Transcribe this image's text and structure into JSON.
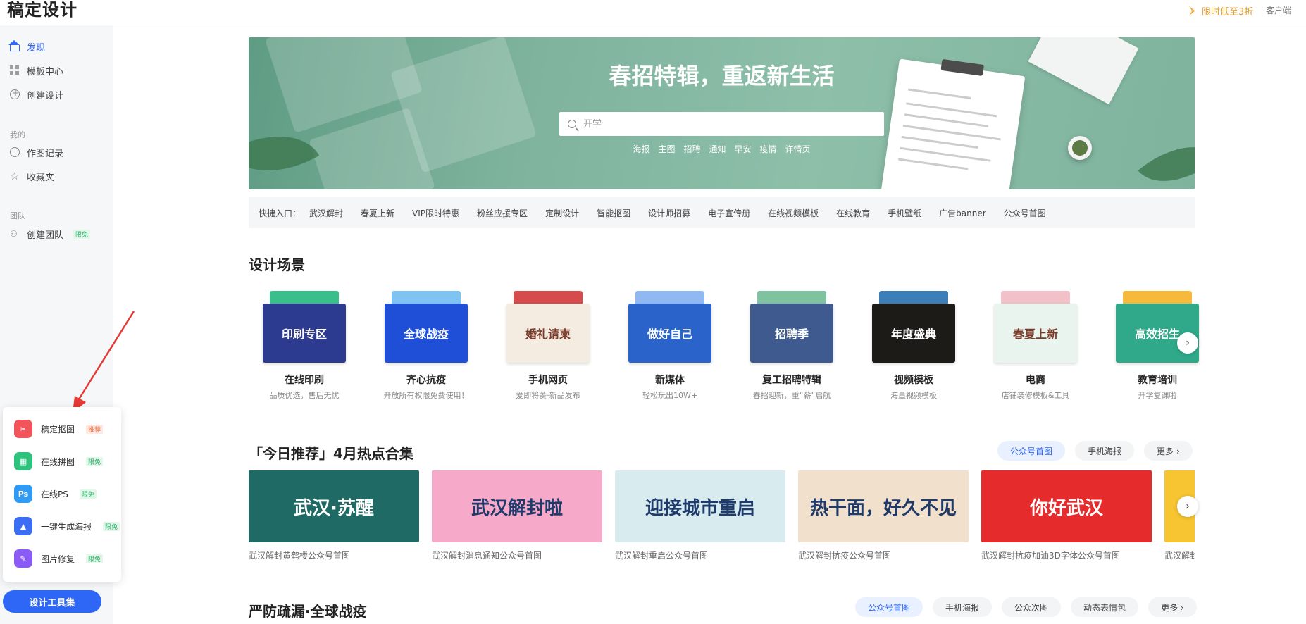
{
  "app": {
    "logo": "稿定设计",
    "promo": "限时低至3折",
    "client": "客户端"
  },
  "sidebar": {
    "main": [
      {
        "label": "发现"
      },
      {
        "label": "模板中心"
      },
      {
        "label": "创建设计"
      }
    ],
    "mine_label": "我的",
    "mine": [
      {
        "label": "作图记录"
      },
      {
        "label": "收藏夹"
      }
    ],
    "team_label": "团队",
    "team": {
      "label": "创建团队",
      "badge": "限免"
    }
  },
  "tools": {
    "items": [
      {
        "label": "稿定抠图",
        "badge": "推荐",
        "icon": "✂",
        "color": "#f2545b"
      },
      {
        "label": "在线拼图",
        "badge": "限免",
        "icon": "▦",
        "color": "#2fc27c"
      },
      {
        "label": "在线PS",
        "badge": "限免",
        "icon": "Ps",
        "color": "#2f9bf5"
      },
      {
        "label": "一键生成海报",
        "badge": "限免",
        "icon": "▲",
        "color": "#3b6df5"
      },
      {
        "label": "图片修复",
        "badge": "限免",
        "icon": "✎",
        "color": "#8a5cf5"
      }
    ],
    "button": "设计工具集"
  },
  "banner": {
    "title": "春招特辑，重返新生活",
    "search_placeholder": "开学",
    "hot_tags": [
      "海报",
      "主图",
      "招聘",
      "通知",
      "早安",
      "疫情",
      "详情页"
    ]
  },
  "quick_entry": {
    "label": "快捷入口：",
    "items": [
      "武汉解封",
      "春夏上新",
      "VIP限时特惠",
      "粉丝应援专区",
      "定制设计",
      "智能抠图",
      "设计师招募",
      "电子宣传册",
      "在线视频模板",
      "在线教育",
      "手机壁纸",
      "广告banner",
      "公众号首图"
    ]
  },
  "scenes": {
    "title": "设计场景",
    "items": [
      {
        "name": "在线印刷",
        "sub": "品质优选，售后无忧",
        "img_text": "印刷专区",
        "front": "#2c3a8f",
        "back": "#3bbf8a"
      },
      {
        "name": "齐心抗疫",
        "sub": "开放所有权限免费使用！",
        "img_text": "全球战疫",
        "front": "#1f4fd6",
        "back": "#7fc3f3"
      },
      {
        "name": "手机网页",
        "sub": "爱即将蒉·新品发布",
        "img_text": "婚礼请柬",
        "front": "#f4ece0",
        "back": "#d64b4b"
      },
      {
        "name": "新媒体",
        "sub": "轻松玩出10W+",
        "img_text": "做好自己",
        "front": "#2a63c9",
        "back": "#8fb9f0"
      },
      {
        "name": "复工招聘特辑",
        "sub": "春招迎新，重“薪”启航",
        "img_text": "招聘季",
        "front": "#3e5a8f",
        "back": "#7fc2a0"
      },
      {
        "name": "视频模板",
        "sub": "海量视频模板",
        "img_text": "年度盛典",
        "front": "#1c1b18",
        "back": "#3c7fb8"
      },
      {
        "name": "电商",
        "sub": "店铺装修模板&工具",
        "img_text": "春夏上新",
        "front": "#e9f4ee",
        "back": "#f2c1c7"
      },
      {
        "name": "教育培训",
        "sub": "开学复课啦",
        "img_text": "高效招生",
        "front": "#2fa98a",
        "back": "#f6b93b"
      }
    ]
  },
  "recommend": {
    "title": "「今日推荐」4月热点合集",
    "tabs": [
      "公众号首图",
      "手机海报",
      "更多 ›"
    ],
    "items": [
      {
        "caption": "武汉解封黄鹤楼公众号首图",
        "img_text": "武汉·苏醒",
        "bg": "#1f6a64"
      },
      {
        "caption": "武汉解封消息通知公众号首图",
        "img_text": "武汉解封啦",
        "bg": "#f7a9c9"
      },
      {
        "caption": "武汉解封重启公众号首图",
        "img_text": "迎接城市重启",
        "bg": "#d8ecf0"
      },
      {
        "caption": "武汉解封抗疫公众号首图",
        "img_text": "热干面，好久不见",
        "bg": "#f1e0cc"
      },
      {
        "caption": "武汉解封抗疫加油3D字体公众号首图",
        "img_text": "你好武汉",
        "bg": "#e52b2b"
      },
      {
        "caption": "武汉解封",
        "img_text": "",
        "bg": "#f6c531"
      }
    ]
  },
  "prevention": {
    "title": "严防疏漏·全球战疫",
    "tabs": [
      "公众号首图",
      "手机海报",
      "公众次图",
      "动态表情包",
      "更多 ›"
    ]
  }
}
